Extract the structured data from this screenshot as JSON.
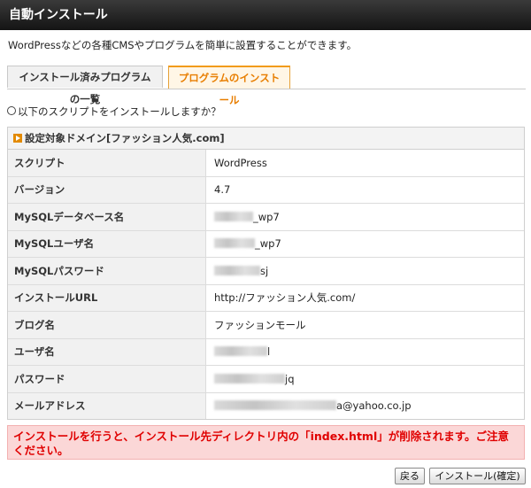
{
  "header": {
    "title": "自動インストール"
  },
  "description": "WordPressなどの各種CMSやプログラムを簡単に設置することができます。",
  "tabs": [
    {
      "label": "インストール済みプログラムの一覧",
      "active": false
    },
    {
      "label": "プログラムのインストール",
      "active": true
    }
  ],
  "question": "以下のスクリプトをインストールしますか？",
  "panel": {
    "title": "設定対象ドメイン[ファッション人気.com]",
    "rows": [
      {
        "label": "スクリプト",
        "value": "WordPress"
      },
      {
        "label": "バージョン",
        "value": "4.7"
      },
      {
        "label": "MySQLデータベース名",
        "value": "_wp7"
      },
      {
        "label": "MySQLユーザ名",
        "value": "_wp7"
      },
      {
        "label": "MySQLパスワード",
        "value": "sj"
      },
      {
        "label": "インストールURL",
        "value": "http://ファッション人気.com/"
      },
      {
        "label": "ブログ名",
        "value": "ファッションモール"
      },
      {
        "label": "ユーザ名",
        "value": "l"
      },
      {
        "label": "パスワード",
        "value": "jq"
      },
      {
        "label": "メールアドレス",
        "value": "a@yahoo.co.jp"
      }
    ]
  },
  "warning": "インストールを行うと、インストール先ディレクトリ内の「index.html」が削除されます。ご注意ください。",
  "buttons": {
    "back": "戻る",
    "install": "インストール(確定)"
  },
  "colors": {
    "accent": "#f29b1a",
    "warning_text": "#e00000",
    "warning_bg": "#fbd7d7"
  }
}
